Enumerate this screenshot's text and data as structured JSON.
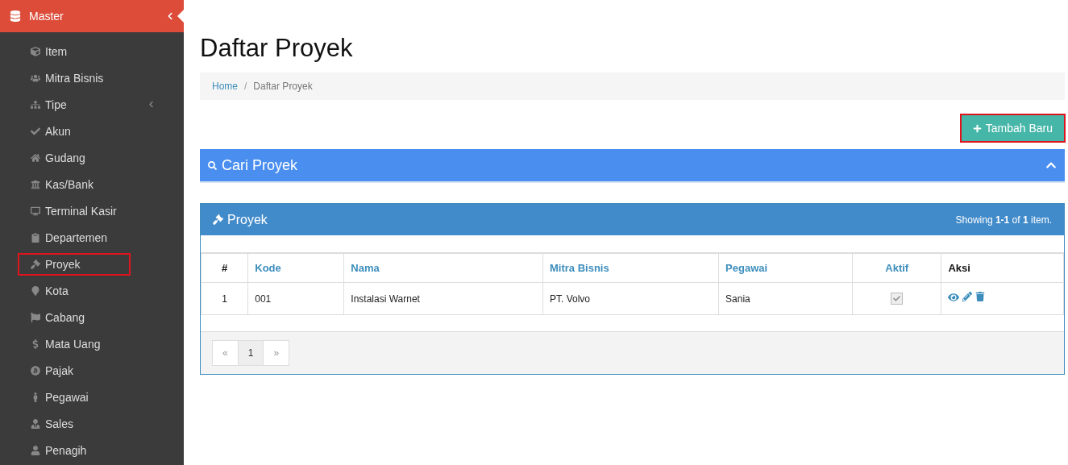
{
  "sidebar": {
    "header": {
      "label": "Master",
      "expanded": true
    },
    "items": [
      {
        "label": "Item",
        "expandable": false,
        "highlighted": false
      },
      {
        "label": "Mitra Bisnis",
        "expandable": false,
        "highlighted": false
      },
      {
        "label": "Tipe",
        "expandable": true,
        "highlighted": false
      },
      {
        "label": "Akun",
        "expandable": false,
        "highlighted": false
      },
      {
        "label": "Gudang",
        "expandable": false,
        "highlighted": false
      },
      {
        "label": "Kas/Bank",
        "expandable": false,
        "highlighted": false
      },
      {
        "label": "Terminal Kasir",
        "expandable": false,
        "highlighted": false
      },
      {
        "label": "Departemen",
        "expandable": false,
        "highlighted": false
      },
      {
        "label": "Proyek",
        "expandable": false,
        "highlighted": true
      },
      {
        "label": "Kota",
        "expandable": false,
        "highlighted": false
      },
      {
        "label": "Cabang",
        "expandable": false,
        "highlighted": false
      },
      {
        "label": "Mata Uang",
        "expandable": false,
        "highlighted": false
      },
      {
        "label": "Pajak",
        "expandable": false,
        "highlighted": false
      },
      {
        "label": "Pegawai",
        "expandable": false,
        "highlighted": false
      },
      {
        "label": "Sales",
        "expandable": false,
        "highlighted": false
      },
      {
        "label": "Penagih",
        "expandable": false,
        "highlighted": false
      }
    ]
  },
  "page_title": "Daftar Proyek",
  "breadcrumb": [
    "Home",
    "Daftar Proyek"
  ],
  "breadcrumb_separator": "/",
  "add_button": {
    "label": "Tambah Baru",
    "highlighted": true
  },
  "search_panel": {
    "title": "Cari Proyek",
    "expanded": false
  },
  "table_panel": {
    "title": "Proyek",
    "summary": "Showing **1-1** of **1** item.",
    "columns": [
      {
        "label": "#",
        "sortable": false
      },
      {
        "label": "Kode",
        "sortable": true
      },
      {
        "label": "Nama",
        "sortable": true
      },
      {
        "label": "Mitra Bisnis",
        "sortable": true
      },
      {
        "label": "Pegawai",
        "sortable": true
      },
      {
        "label": "Aktif",
        "sortable": true
      },
      {
        "label": "Aksi",
        "sortable": false
      }
    ],
    "rows": [
      {
        "no": "1",
        "kode": "001",
        "nama": "Instalasi Warnet",
        "mitra": "PT. Volvo",
        "pegawai": "Sania",
        "aktif": true
      }
    ],
    "pagination": {
      "prev": "«",
      "pages": [
        {
          "label": "1",
          "selected": true
        }
      ],
      "next": "»"
    }
  }
}
